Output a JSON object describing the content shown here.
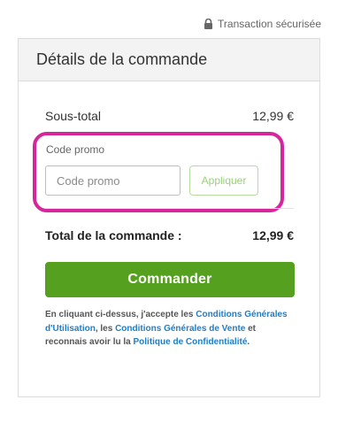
{
  "secure": {
    "text": "Transaction sécurisée",
    "icon": "lock-icon"
  },
  "panel": {
    "title": "Détails de la commande"
  },
  "subtotal": {
    "label": "Sous-total",
    "value": "12,99 €"
  },
  "promo": {
    "label": "Code promo",
    "placeholder": "Code promo",
    "value": "",
    "apply_label": "Appliquer",
    "highlight_color": "#d6269c"
  },
  "total": {
    "label": "Total de la commande :",
    "value": "12,99 €"
  },
  "order_button": {
    "label": "Commander",
    "color": "#56a01f"
  },
  "legal": {
    "text1": "En cliquant ci-dessus, j'accepte les ",
    "link1": "Conditions Générales d'Utilisation",
    "text2": ", les ",
    "link2": "Conditions Générales de Vente",
    "text3": " et reconnais avoir lu la ",
    "link3": "Politique de Confidentialité",
    "text4": ".",
    "link_color": "#1f7ec6"
  }
}
